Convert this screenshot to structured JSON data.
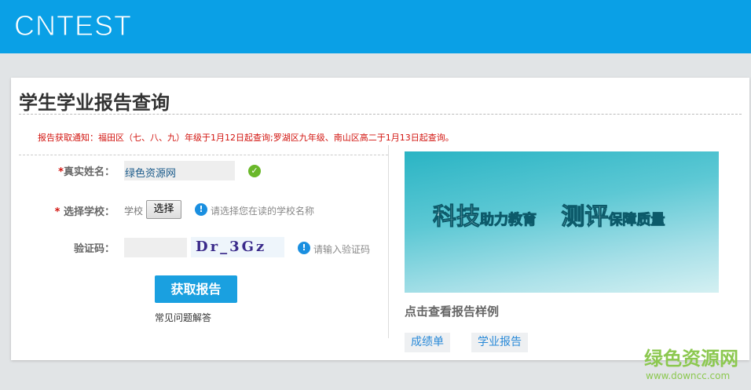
{
  "header": {
    "logo": "CNTEST"
  },
  "page": {
    "title": "学生学业报告查询",
    "notice": "报告获取通知：福田区（七、八、九）年级于1月12日起查询;罗湖区九年级、南山区高二于1月13日起查询。"
  },
  "form": {
    "name_label": "真实姓名：",
    "name_value": "绿色资源网",
    "school_label": " 选择学校：",
    "school_text": "学校",
    "school_button": "选择",
    "school_hint": "请选择您在读的学校名称",
    "captcha_label": "验证码：",
    "captcha_value": "",
    "captcha_image": "Dr_3Gz",
    "captcha_hint": "请输入验证码",
    "required_mark": "*",
    "submit": "获取报告",
    "faq": "常见问题解答"
  },
  "banner": {
    "main1": "科技",
    "sub1": "助力教育",
    "main2": "测评",
    "sub2": "保障质量"
  },
  "samples": {
    "title": "点击查看报告样例",
    "items": [
      "成绩单",
      "学业报告"
    ]
  },
  "watermark": {
    "name": "绿色资源网",
    "url": "www.downcc.com"
  }
}
